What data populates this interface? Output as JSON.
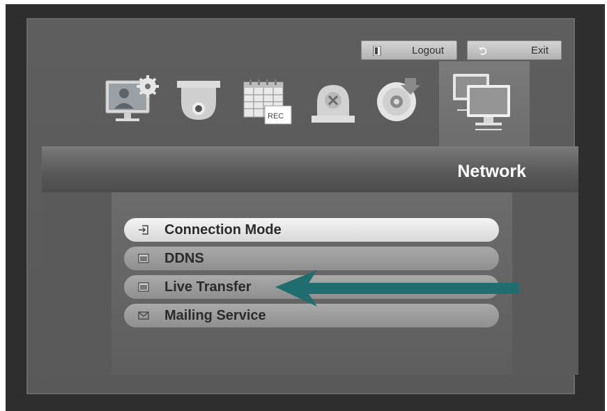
{
  "header": {
    "logout_label": "Logout",
    "exit_label": "Exit"
  },
  "top_menu": {
    "icons": [
      "monitor-settings-icon",
      "dome-camera-icon",
      "record-schedule-icon",
      "event-alarm-icon",
      "backup-disc-icon",
      "network-icon"
    ],
    "active": "network-icon"
  },
  "page": {
    "title": "Network"
  },
  "submenu": {
    "items": [
      {
        "label": "Connection Mode",
        "icon": "login-icon",
        "selected": true
      },
      {
        "label": "DDNS",
        "icon": "window-icon",
        "selected": false
      },
      {
        "label": "Live Transfer",
        "icon": "window-icon",
        "selected": false
      },
      {
        "label": "Mailing Service",
        "icon": "envelope-icon",
        "selected": false
      }
    ]
  },
  "annotation": {
    "arrow_color": "#1f6d6f",
    "points_to": "Live Transfer"
  }
}
